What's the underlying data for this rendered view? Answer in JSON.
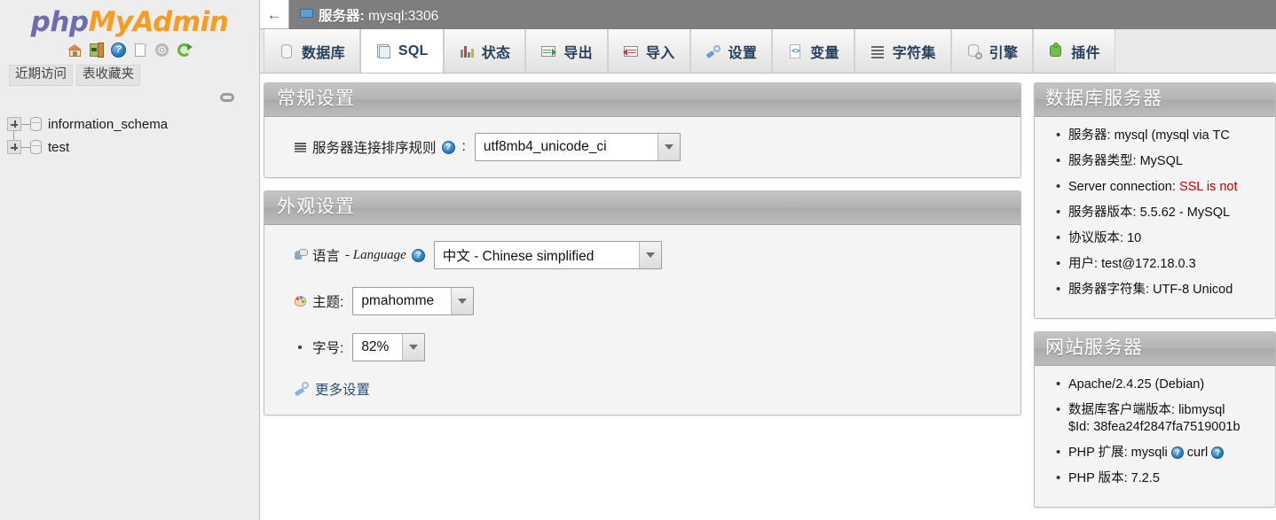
{
  "app": {
    "logo_php": "php",
    "logo_my": "My",
    "logo_admin": "Admin"
  },
  "navpanel": {
    "icons": [
      {
        "name": "home-icon",
        "label": "主页"
      },
      {
        "name": "logout-icon",
        "label": "退出"
      },
      {
        "name": "help-doc-icon",
        "label": "帮助"
      },
      {
        "name": "docs-icon",
        "label": "文档"
      },
      {
        "name": "settings-gear-icon",
        "label": "设置"
      },
      {
        "name": "reload-icon",
        "label": "重新载入"
      }
    ],
    "tabs": [
      {
        "label": "近期访问",
        "active": true
      },
      {
        "label": "表收藏夹",
        "active": false
      }
    ],
    "databases": [
      {
        "name": "information_schema"
      },
      {
        "name": "test"
      }
    ]
  },
  "serverbar": {
    "back_arrow": "←",
    "title": "服务器:",
    "host": "mysql:3306"
  },
  "tabs": [
    {
      "label": "数据库",
      "icon": "database-icon",
      "active": false,
      "latin": false
    },
    {
      "label": "SQL",
      "icon": "sql-icon",
      "active": true,
      "latin": true
    },
    {
      "label": "状态",
      "icon": "status-icon",
      "active": false,
      "latin": false
    },
    {
      "label": "导出",
      "icon": "export-icon",
      "active": false,
      "latin": false
    },
    {
      "label": "导入",
      "icon": "import-icon",
      "active": false,
      "latin": false
    },
    {
      "label": "设置",
      "icon": "settings-icon",
      "active": false,
      "latin": false
    },
    {
      "label": "变量",
      "icon": "variables-icon",
      "active": false,
      "latin": false
    },
    {
      "label": "字符集",
      "icon": "charset-icon",
      "active": false,
      "latin": false
    },
    {
      "label": "引擎",
      "icon": "engine-icon",
      "active": false,
      "latin": false
    },
    {
      "label": "插件",
      "icon": "plugin-icon",
      "active": false,
      "latin": false
    }
  ],
  "general_settings": {
    "title": "常规设置",
    "collation_label": "服务器连接排序规则",
    "collation_help": "?",
    "colon": ":",
    "collation_value": "utf8mb4_unicode_ci"
  },
  "appearance_settings": {
    "title": "外观设置",
    "language_label": "语言",
    "language_label_latin": "- Language",
    "language_help": "?",
    "language_value": "中文 - Chinese simplified",
    "theme_label": "主题:",
    "theme_value": "pmahomme",
    "fontsize_label": "字号:",
    "fontsize_value": "82%",
    "more_settings": "更多设置"
  },
  "db_server": {
    "title": "数据库服务器",
    "items": [
      {
        "key": "服务器:",
        "value": "mysql (mysql via TC",
        "warn": false
      },
      {
        "key": "服务器类型:",
        "value": "MySQL",
        "warn": false
      },
      {
        "key": "Server connection:",
        "value": "SSL is not",
        "warn": true
      },
      {
        "key": "服务器版本:",
        "value": "5.5.62 - MySQL",
        "warn": false
      },
      {
        "key": "协议版本:",
        "value": "10",
        "warn": false
      },
      {
        "key": "用户:",
        "value": "test@172.18.0.3",
        "warn": false
      },
      {
        "key": "服务器字符集:",
        "value": "UTF-8 Unicod",
        "warn": false
      }
    ]
  },
  "web_server": {
    "title": "网站服务器",
    "items": [
      {
        "key": "",
        "value": "Apache/2.4.25 (Debian)",
        "warn": false
      },
      {
        "key": "数据库客户端版本:",
        "value": "libmysql",
        "value2": "$Id: 38fea24f2847fa7519001b",
        "warn": false
      },
      {
        "key": "PHP 扩展:",
        "value": "mysqli",
        "value_b": "curl",
        "warn": false,
        "has_help": true
      },
      {
        "key": "PHP 版本:",
        "value": "7.2.5",
        "warn": false
      }
    ]
  },
  "colors": {
    "logo_blue": "#6c6cae",
    "logo_orange": "#f89b22",
    "panel_header_gray": "#b4b4b4",
    "serverbar_gray": "#7e7e7e",
    "tab_text_blue": "#27405b",
    "warn_red": "#c00000",
    "link_blue": "#2b4f77"
  }
}
